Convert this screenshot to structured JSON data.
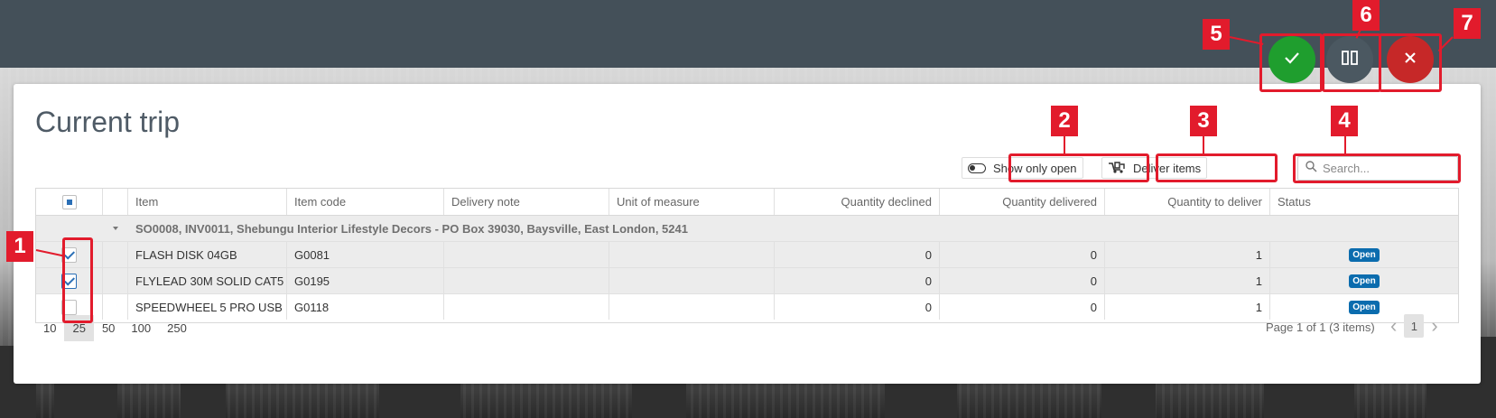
{
  "page": {
    "title": "Current trip"
  },
  "toolbar": {
    "show_only_open_label": "Show only open",
    "deliver_items_label": "Deliver items",
    "search_placeholder": "Search..."
  },
  "grid": {
    "columns": [
      "Item",
      "Item code",
      "Delivery note",
      "Unit of measure",
      "Quantity declined",
      "Quantity delivered",
      "Quantity to deliver",
      "Status"
    ],
    "group_label": "SO0008, INV0011, Shebungu Interior Lifestyle Decors - PO Box 39030, Baysville, East London, 5241",
    "rows": [
      {
        "item": "FLASH DISK 04GB",
        "item_code": "G0081",
        "delivery_note": "",
        "unit_of_measure": "",
        "qty_declined": "0",
        "qty_delivered": "0",
        "qty_to_deliver": "1",
        "status": "Open",
        "checked": true
      },
      {
        "item": "FLYLEAD 30M SOLID CAT5",
        "item_code": "G0195",
        "delivery_note": "",
        "unit_of_measure": "",
        "qty_declined": "0",
        "qty_delivered": "0",
        "qty_to_deliver": "1",
        "status": "Open",
        "checked": true
      },
      {
        "item": "SPEEDWHEEL 5 PRO USB",
        "item_code": "G0118",
        "delivery_note": "",
        "unit_of_measure": "",
        "qty_declined": "0",
        "qty_delivered": "0",
        "qty_to_deliver": "1",
        "status": "Open",
        "checked": false
      }
    ]
  },
  "pager": {
    "sizes": [
      "10",
      "25",
      "50",
      "100",
      "250"
    ],
    "active_size": "25",
    "info": "Page 1 of 1 (3 items)",
    "current_page": "1"
  },
  "actions": {
    "confirm_icon": "checkmark-icon",
    "pause_icon": "pause-icon",
    "cancel_icon": "close-icon"
  },
  "annotations": [
    "1",
    "2",
    "3",
    "4",
    "5",
    "6",
    "7"
  ],
  "colors": {
    "annotation_red": "#e21b2c",
    "confirm_green": "#1f9e2e",
    "pause_slate": "#4b5861",
    "cancel_red": "#c62828",
    "status_blue": "#0b6cae",
    "header_slate": "#445059"
  }
}
